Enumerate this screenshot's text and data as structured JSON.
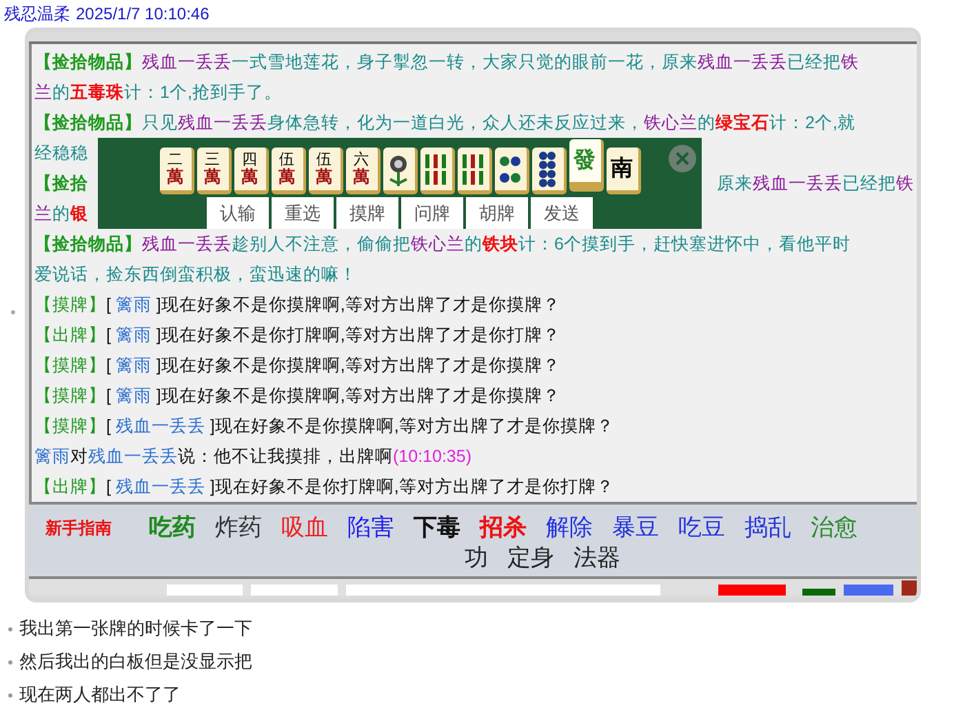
{
  "post_header": {
    "author": "残忍温柔",
    "time": "2025/1/7 10:10:46"
  },
  "chat_lines": [
    {
      "left": [
        {
          "kind": "pickup_tag",
          "text": "【捡拾物品】"
        },
        {
          "kind": "actor",
          "text": "残血一丢丢"
        },
        {
          "kind": "narration",
          "text": "一式雪地莲花，身子掣忽一转，大家只觉的眼前一花，原来"
        },
        {
          "kind": "actor",
          "text": "残血一丢丢"
        },
        {
          "kind": "narration",
          "text": "已经把"
        },
        {
          "kind": "actor",
          "text": "铁"
        }
      ]
    },
    {
      "left": [
        {
          "kind": "actor",
          "text": "兰"
        },
        {
          "kind": "narration",
          "text": "的"
        },
        {
          "kind": "item",
          "text": "五毒珠"
        },
        {
          "kind": "narration",
          "text": "计：1个,抢到手了。"
        }
      ]
    },
    {
      "left": [
        {
          "kind": "pickup_tag",
          "text": "【捡拾物品】"
        },
        {
          "kind": "narration",
          "text": "只见"
        },
        {
          "kind": "actor",
          "text": "残血一丢丢"
        },
        {
          "kind": "narration",
          "text": "身体急转，化为一道白光，众人还未反应过来，"
        },
        {
          "kind": "actor",
          "text": "铁心兰"
        },
        {
          "kind": "narration",
          "text": "的"
        },
        {
          "kind": "item",
          "text": "绿宝石"
        },
        {
          "kind": "narration",
          "text": "计：2个,就"
        }
      ]
    },
    {
      "left": [
        {
          "kind": "narration",
          "text": "经稳稳"
        }
      ]
    },
    {
      "left": [
        {
          "kind": "pickup_tag",
          "text": "【捡拾"
        }
      ],
      "right": [
        {
          "kind": "narration",
          "text": "原来"
        },
        {
          "kind": "actor",
          "text": "残血一丢丢"
        },
        {
          "kind": "narration",
          "text": "已经把"
        },
        {
          "kind": "actor",
          "text": "铁"
        }
      ]
    },
    {
      "left": [
        {
          "kind": "actor",
          "text": "兰"
        },
        {
          "kind": "narration",
          "text": "的"
        },
        {
          "kind": "item",
          "text": "银"
        }
      ]
    },
    {
      "left": [
        {
          "kind": "pickup_tag",
          "text": "【捡拾物品】"
        },
        {
          "kind": "actor",
          "text": "残血一丢丢"
        },
        {
          "kind": "narration",
          "text": "趁别人不注意，偷偷把"
        },
        {
          "kind": "actor",
          "text": "铁心兰"
        },
        {
          "kind": "narration",
          "text": "的"
        },
        {
          "kind": "item",
          "text": "铁块"
        },
        {
          "kind": "narration",
          "text": "计：6个摸到手，赶快塞进怀中，看他平时"
        }
      ]
    },
    {
      "left": [
        {
          "kind": "narration",
          "text": "爱说话，捡东西倒蛮积极，蛮迅速的嘛！"
        }
      ]
    },
    {
      "left": [
        {
          "kind": "game_tag",
          "text": "【摸牌】"
        },
        {
          "kind": "message",
          "text": "[ "
        },
        {
          "kind": "player",
          "text": "篱雨"
        },
        {
          "kind": "message",
          "text": " ]现在好象不是你摸牌啊,等对方出牌了才是你摸牌？"
        }
      ]
    },
    {
      "left": [
        {
          "kind": "game_tag",
          "text": "【出牌】"
        },
        {
          "kind": "message",
          "text": "[ "
        },
        {
          "kind": "player",
          "text": "篱雨"
        },
        {
          "kind": "message",
          "text": " ]现在好象不是你打牌啊,等对方出牌了才是你打牌？"
        }
      ]
    },
    {
      "left": [
        {
          "kind": "game_tag",
          "text": "【摸牌】"
        },
        {
          "kind": "message",
          "text": "[ "
        },
        {
          "kind": "player",
          "text": "篱雨"
        },
        {
          "kind": "message",
          "text": " ]现在好象不是你摸牌啊,等对方出牌了才是你摸牌？"
        }
      ]
    },
    {
      "left": [
        {
          "kind": "game_tag",
          "text": "【摸牌】"
        },
        {
          "kind": "message",
          "text": "[ "
        },
        {
          "kind": "player",
          "text": "篱雨"
        },
        {
          "kind": "message",
          "text": " ]现在好象不是你摸牌啊,等对方出牌了才是你摸牌？"
        }
      ]
    },
    {
      "left": [
        {
          "kind": "game_tag",
          "text": "【摸牌】"
        },
        {
          "kind": "message",
          "text": "[ "
        },
        {
          "kind": "player",
          "text": "残血一丢丢"
        },
        {
          "kind": "message",
          "text": " ]现在好象不是你摸牌啊,等对方出牌了才是你摸牌？"
        }
      ]
    },
    {
      "left": [
        {
          "kind": "player",
          "text": "篱雨"
        },
        {
          "kind": "message",
          "text": "对"
        },
        {
          "kind": "player",
          "text": "残血一丢丢"
        },
        {
          "kind": "message",
          "text": "说：他不让我摸排，出牌啊"
        },
        {
          "kind": "time",
          "text": "(10:10:35)"
        }
      ]
    },
    {
      "left": [
        {
          "kind": "game_tag",
          "text": "【出牌】"
        },
        {
          "kind": "message",
          "text": "[ "
        },
        {
          "kind": "player",
          "text": "残血一丢丢"
        },
        {
          "kind": "message",
          "text": " ]现在好象不是你打牌啊,等对方出牌了才是你打牌？"
        }
      ]
    }
  ],
  "mahjong_panel": {
    "tiles": [
      {
        "kind": "character",
        "numeral": "二",
        "suit": "萬",
        "selected": false
      },
      {
        "kind": "character",
        "numeral": "三",
        "suit": "萬",
        "selected": false
      },
      {
        "kind": "character",
        "numeral": "四",
        "suit": "萬",
        "selected": false
      },
      {
        "kind": "character",
        "numeral": "伍",
        "suit": "萬",
        "selected": false
      },
      {
        "kind": "character",
        "numeral": "伍",
        "suit": "萬",
        "selected": false
      },
      {
        "kind": "character",
        "numeral": "六",
        "suit": "萬",
        "selected": false
      },
      {
        "kind": "flower",
        "selected": false
      },
      {
        "kind": "bamboo",
        "selected": false
      },
      {
        "kind": "bamboo",
        "selected": false
      },
      {
        "kind": "four_dots",
        "selected": false
      },
      {
        "kind": "eight_dots",
        "selected": false
      },
      {
        "kind": "green_honor",
        "face": "發",
        "selected": true
      },
      {
        "kind": "black_honor",
        "face": "南",
        "selected": false
      }
    ],
    "buttons": [
      "认输",
      "重选",
      "摸牌",
      "问牌",
      "胡牌",
      "发送"
    ]
  },
  "menu": {
    "guide": "新手指南",
    "rows": [
      [
        {
          "label": "吃药",
          "color": "#1f8a1f",
          "bold": true
        },
        {
          "label": "炸药",
          "color": "#333333",
          "bold": false
        },
        {
          "label": "吸血",
          "color": "#ee2222",
          "bold": false
        },
        {
          "label": "陷害",
          "color": "#1a1aee",
          "bold": false
        },
        {
          "label": "下毒",
          "color": "#111111",
          "bold": true
        },
        {
          "label": "招杀",
          "color": "#ee1111",
          "bold": true
        },
        {
          "label": "解除",
          "color": "#2233dd",
          "bold": false
        },
        {
          "label": "暴豆",
          "color": "#2233dd",
          "bold": false
        },
        {
          "label": "吃豆",
          "color": "#2233dd",
          "bold": false
        },
        {
          "label": "捣乱",
          "color": "#2233dd",
          "bold": false
        },
        {
          "label": "治愈",
          "color": "#2a8a2a",
          "bold": false
        }
      ],
      [
        {
          "label": "功",
          "color": "#222222",
          "bold": false
        },
        {
          "label": "定身",
          "color": "#222222",
          "bold": false
        },
        {
          "label": "法器",
          "color": "#222222",
          "bold": false
        }
      ]
    ]
  },
  "comments": [
    "我出第一张牌的时候卡了一下",
    "然后我出的白板但是没显示把",
    "现在两人都出不了了"
  ]
}
